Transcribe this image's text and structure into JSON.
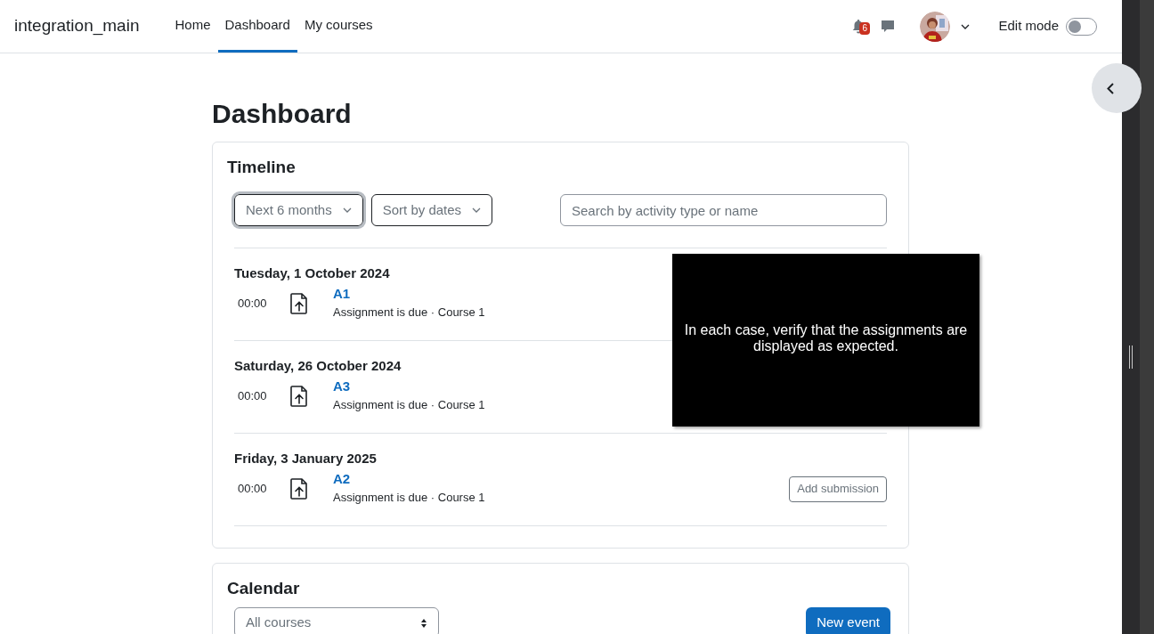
{
  "navbar": {
    "site_name": "integration_main",
    "links": [
      {
        "label": "Home",
        "selected": false
      },
      {
        "label": "Dashboard",
        "selected": true
      },
      {
        "label": "My courses",
        "selected": false
      }
    ],
    "notification_count": "6",
    "edit_mode": {
      "label": "Edit mode",
      "on": false
    }
  },
  "page_title": "Dashboard",
  "timeline": {
    "title": "Timeline",
    "filter": "Next 6 months",
    "sort": "Sort by dates",
    "search": {
      "placeholder": "Search by activity type or name"
    },
    "days": [
      {
        "date": "Tuesday, 1 October 2024",
        "events": [
          {
            "time": "00:00",
            "name": "A1",
            "detail": "Assignment is due · Course 1"
          }
        ]
      },
      {
        "date": "Saturday, 26 October 2024",
        "events": [
          {
            "time": "00:00",
            "name": "A3",
            "detail": "Assignment is due · Course 1"
          }
        ]
      },
      {
        "date": "Friday, 3 January 2025",
        "events": [
          {
            "time": "00:00",
            "name": "A2",
            "detail": "Assignment is due · Course 1",
            "action": "Add submission"
          }
        ]
      }
    ]
  },
  "calendar": {
    "title": "Calendar",
    "course_select": "All courses",
    "new_event": "New event"
  },
  "overlay": {
    "text": "In each case, verify that the assignments are displayed as expected."
  }
}
